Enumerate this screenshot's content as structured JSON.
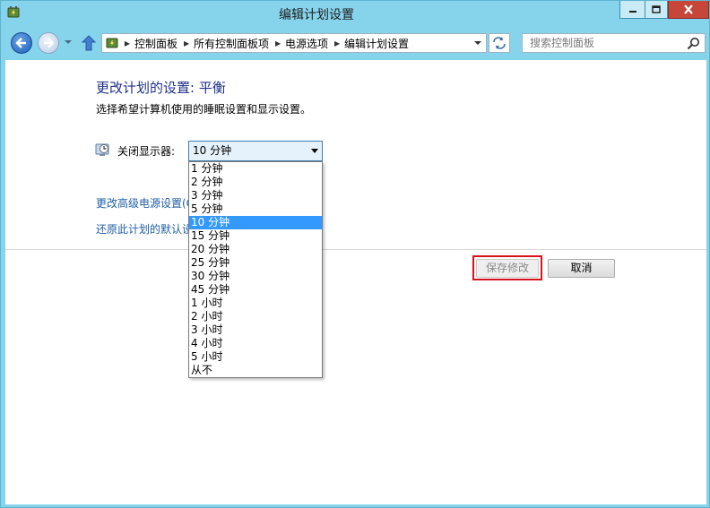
{
  "window": {
    "title": "编辑计划设置",
    "app_icon": "power-options-icon"
  },
  "titlebar_buttons": [
    "minimize-icon",
    "maximize-icon",
    "close-icon"
  ],
  "address_bar": {
    "breadcrumbs": [
      "控制面板",
      "所有控制面板项",
      "电源选项",
      "编辑计划设置"
    ]
  },
  "search": {
    "placeholder": "搜索控制面板"
  },
  "main": {
    "heading": "更改计划的设置: 平衡",
    "subtitle": "选择希望计算机使用的睡眠设置和显示设置。",
    "display_label": "关闭显示器:",
    "display_value": "10 分钟",
    "link_advanced": "更改高级电源设置(C)",
    "link_restore": "还原此计划的默认设置",
    "save_label": "保存修改",
    "cancel_label": "取消"
  },
  "dropdown": {
    "options": [
      "1 分钟",
      "2 分钟",
      "3 分钟",
      "5 分钟",
      "10 分钟",
      "15 分钟",
      "20 分钟",
      "25 分钟",
      "30 分钟",
      "45 分钟",
      "1 小时",
      "2 小时",
      "3 小时",
      "4 小时",
      "5 小时",
      "从不"
    ],
    "selected_index": 4
  },
  "colors": {
    "frame": "#86d3ec",
    "heading": "#1e3287",
    "link": "#1f5fa8",
    "selection": "#3399ff",
    "highlight_box": "#d6131b",
    "close_button": "#c7463a"
  }
}
